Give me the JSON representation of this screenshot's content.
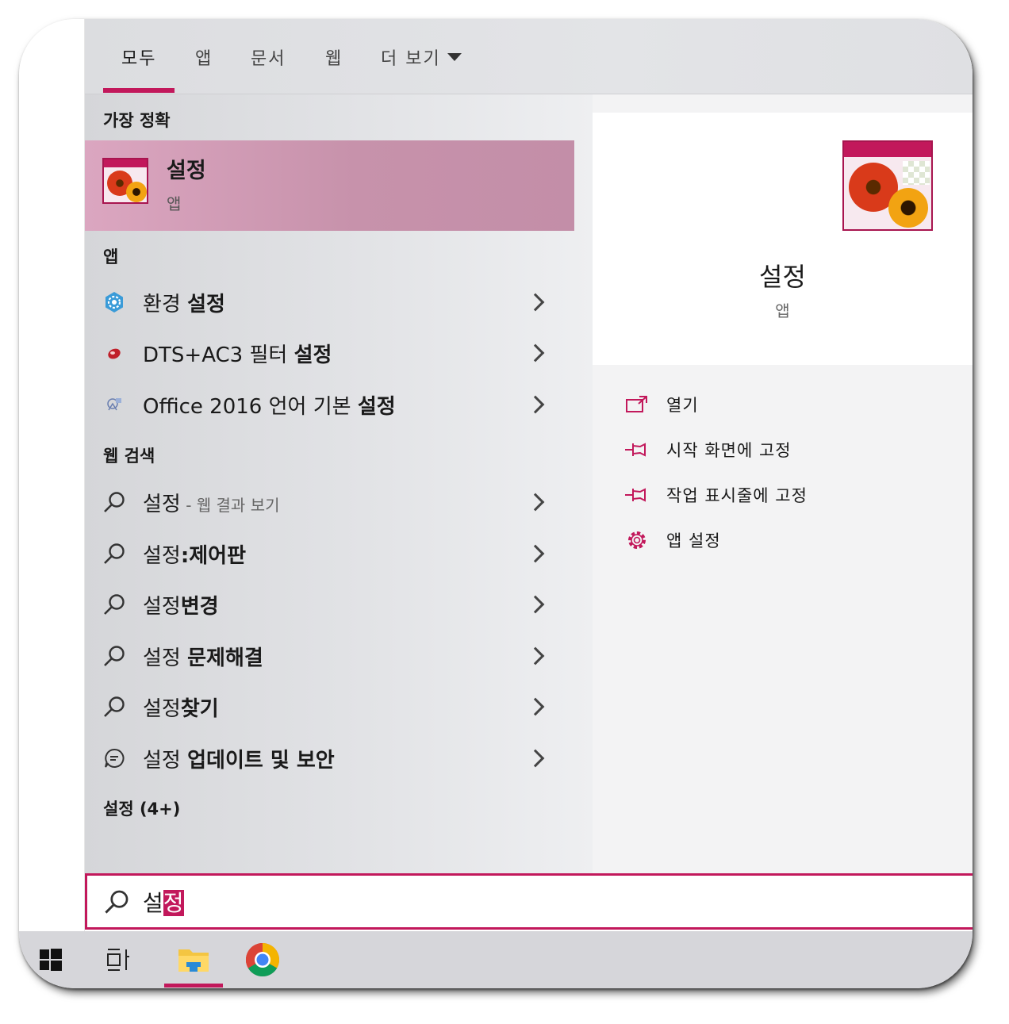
{
  "tabs": [
    {
      "label": "모두",
      "active": true
    },
    {
      "label": "앱",
      "active": false
    },
    {
      "label": "문서",
      "active": false
    },
    {
      "label": "웹",
      "active": false
    }
  ],
  "more_tab": {
    "label": "더 보기"
  },
  "sections": {
    "best_match": "가장 정확",
    "apps": "앱",
    "web": "웹 검색",
    "settings": "설정 (4+)"
  },
  "best_match": {
    "title": "설정",
    "subtitle": "앱"
  },
  "apps": [
    {
      "normal": "환경 ",
      "bold": "설정",
      "icon": "gear-blue-icon"
    },
    {
      "normal": "DTS+AC3 필터 ",
      "bold": "설정",
      "icon": "filter-red-icon"
    },
    {
      "normal": "Office 2016 언어 기본 ",
      "bold": "설정",
      "icon": "office-language-icon"
    }
  ],
  "web_results": [
    {
      "normal": "설정",
      "suffix": " - 웹 결과 보기",
      "bold": ""
    },
    {
      "normal": "설정",
      "bold": ":제어판"
    },
    {
      "normal": "설정",
      "bold": "변경"
    },
    {
      "normal": "설정 ",
      "bold": "문제해결"
    },
    {
      "normal": "설정",
      "bold": "찾기"
    }
  ],
  "settings_result": {
    "normal": "설정 ",
    "bold": "업데이트 및 보안"
  },
  "preview": {
    "title": "설정",
    "subtitle": "앱"
  },
  "actions": [
    {
      "label": "열기",
      "icon": "open-icon"
    },
    {
      "label": "시작 화면에 고정",
      "icon": "pin-icon"
    },
    {
      "label": "작업 표시줄에 고정",
      "icon": "pin-icon"
    },
    {
      "label": "앱 설정",
      "icon": "gear-icon"
    }
  ],
  "search": {
    "typed": "설",
    "selected": "정"
  },
  "colors": {
    "accent": "#c2185b",
    "highlight": "#c792ab",
    "taskbar": "#d6d6da"
  }
}
